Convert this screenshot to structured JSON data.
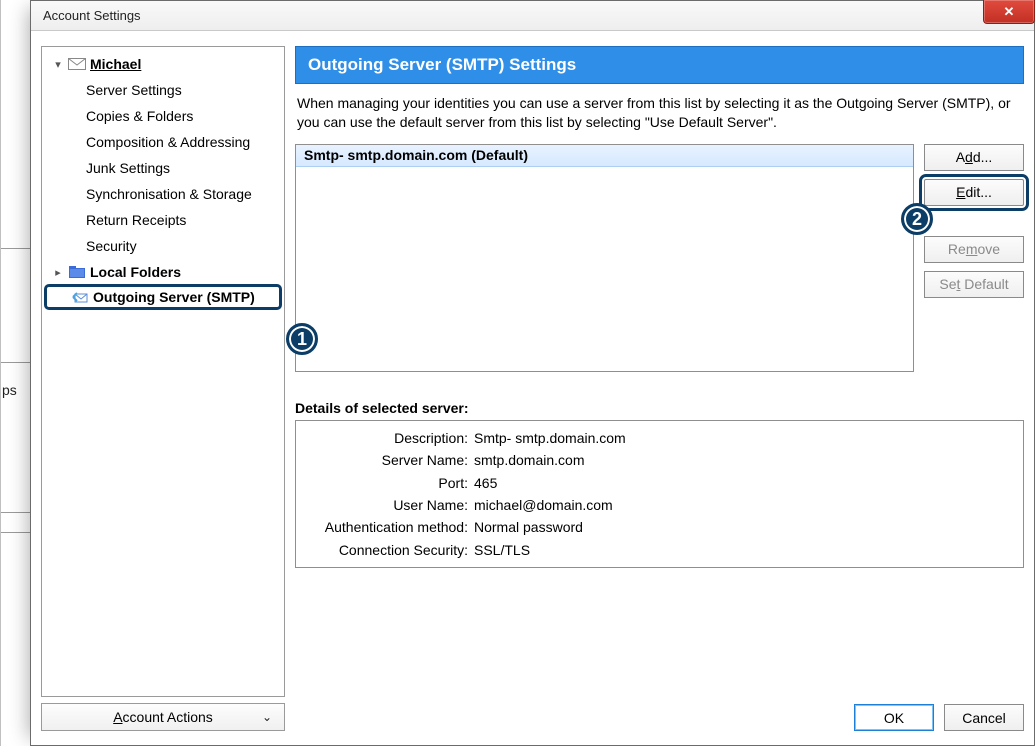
{
  "window": {
    "title": "Account Settings",
    "close_x": "✕"
  },
  "tree": {
    "account_name": "Michael",
    "items": [
      "Server Settings",
      "Copies & Folders",
      "Composition & Addressing",
      "Junk Settings",
      "Synchronisation & Storage",
      "Return Receipts",
      "Security"
    ],
    "local_folders": "Local Folders",
    "outgoing": "Outgoing Server (SMTP)"
  },
  "account_actions_label": "Account Actions",
  "account_actions_prefix": "A",
  "account_actions_rest": "ccount Actions",
  "main": {
    "banner": "Outgoing Server (SMTP) Settings",
    "description": "When managing your identities you can use a server from this list by selecting it as the Outgoing Server (SMTP), or you can use the default server from this list by selecting \"Use Default Server\".",
    "server_row": "Smtp- smtp.domain.com (Default)",
    "buttons": {
      "add_pre": "A",
      "add_u": "d",
      "add_post": "d...",
      "edit_pre": "",
      "edit_u": "E",
      "edit_post": "dit...",
      "remove_pre": "Re",
      "remove_u": "m",
      "remove_post": "ove",
      "default_pre": "Se",
      "default_u": "t",
      "default_post": " Default"
    },
    "details_title": "Details of selected server:",
    "details": {
      "description_label": "Description:",
      "description_value": "Smtp- smtp.domain.com",
      "server_name_label": "Server Name:",
      "server_name_value": "smtp.domain.com",
      "port_label": "Port:",
      "port_value": "465",
      "user_name_label": "User Name:",
      "user_name_value": "michael@domain.com",
      "auth_label": "Authentication method:",
      "auth_value": "Normal password",
      "security_label": "Connection Security:",
      "security_value": "SSL/TLS"
    }
  },
  "footer": {
    "ok": "OK",
    "cancel": "Cancel"
  },
  "bg_text": "ps",
  "annotations": {
    "one": "1",
    "two": "2"
  }
}
